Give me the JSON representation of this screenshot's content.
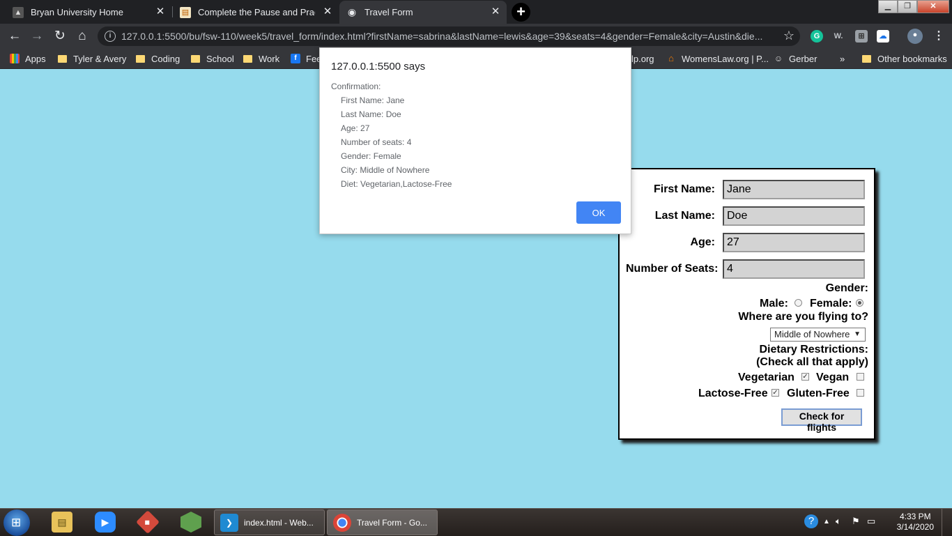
{
  "browser": {
    "tabs": [
      {
        "title": "Bryan University Home",
        "icon": "mountain-icon",
        "active": false
      },
      {
        "title": "Complete the Pause and Practice",
        "icon": "document-icon",
        "active": false
      },
      {
        "title": "Travel Form",
        "icon": "globe-icon",
        "active": true
      }
    ],
    "url": "127.0.0.1:5500/bu/fsw-110/week5/travel_form/index.html?firstName=sabrina&lastName=lewis&age=39&seats=4&gender=Female&city=Austin&die...",
    "bookmarks": [
      {
        "label": "Apps",
        "icon": "apps-grid-icon"
      },
      {
        "label": "Tyler & Avery",
        "icon": "folder-icon"
      },
      {
        "label": "Coding",
        "icon": "folder-icon"
      },
      {
        "label": "School",
        "icon": "folder-icon"
      },
      {
        "label": "Work",
        "icon": "folder-icon"
      },
      {
        "label": "Fee",
        "icon": "facebook-icon"
      },
      {
        "label": "lp.org",
        "icon": ""
      },
      {
        "label": "WomensLaw.org | P...",
        "icon": "house-icon"
      },
      {
        "label": "Gerber",
        "icon": "baby-icon"
      },
      {
        "label": "»",
        "icon": ""
      },
      {
        "label": "Other bookmarks",
        "icon": "folder-icon"
      }
    ]
  },
  "dialog": {
    "title": "127.0.0.1:5500 says",
    "lines": [
      "Confirmation:",
      "First Name: Jane",
      "Last Name: Doe",
      "Age: 27",
      "Number of seats: 4",
      "Gender: Female",
      "City: Middle of Nowhere",
      "Diet: Vegetarian,Lactose-Free"
    ],
    "ok_label": "OK"
  },
  "form": {
    "first_name_label": "First Name:",
    "first_name_value": "Jane",
    "last_name_label": "Last Name:",
    "last_name_value": "Doe",
    "age_label": "Age:",
    "age_value": "27",
    "seats_label": "Number of Seats:",
    "seats_value": "4",
    "gender_label": "Gender:",
    "male_label": "Male:",
    "female_label": "Female:",
    "gender_selected": "Female",
    "city_label": "Where are you flying to?",
    "city_value": "Middle of Nowhere",
    "diet_label": "Dietary Restrictions:",
    "diet_sublabel": "(Check all that apply)",
    "vegetarian_label": "Vegetarian",
    "vegetarian_checked": true,
    "vegan_label": "Vegan",
    "vegan_checked": false,
    "lactose_label": "Lactose-Free",
    "lactose_checked": true,
    "gluten_label": "Gluten-Free",
    "gluten_checked": false,
    "submit_label": "Check for flights"
  },
  "taskbar": {
    "tasks": [
      {
        "label": "index.html - Web...",
        "icon": "vscode-icon"
      },
      {
        "label": "Travel Form - Go...",
        "icon": "chrome-icon"
      }
    ],
    "time": "4:33 PM",
    "date": "3/14/2020"
  },
  "colors": {
    "page_background": "#96dbed",
    "dialog_button": "#4285f4",
    "browser_chrome": "#35363a"
  }
}
